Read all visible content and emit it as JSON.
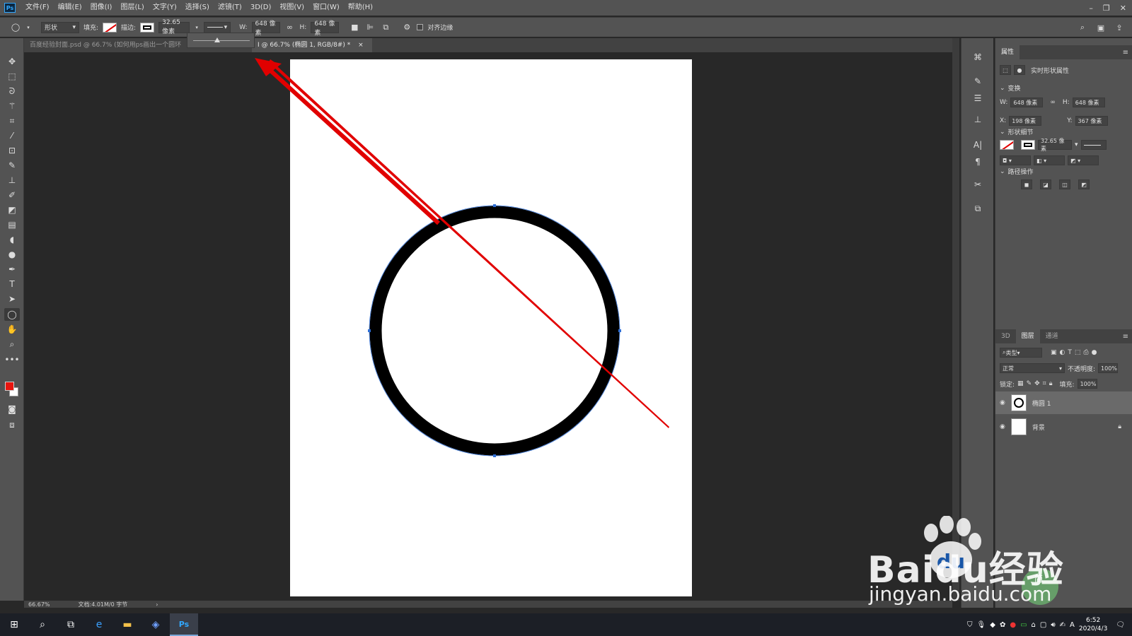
{
  "app": {
    "logo": "Ps"
  },
  "menu": [
    "文件(F)",
    "编辑(E)",
    "图像(I)",
    "图层(L)",
    "文字(Y)",
    "选择(S)",
    "滤镜(T)",
    "3D(D)",
    "视图(V)",
    "窗口(W)",
    "帮助(H)"
  ],
  "options": {
    "mode": "形状",
    "fill_label": "填充:",
    "stroke_label": "描边:",
    "stroke_width": "32.65 像素",
    "w_label": "W:",
    "w_value": "648 像素",
    "h_label": "H:",
    "h_value": "648 像素",
    "align_edges": "对齐边缘"
  },
  "tabs": [
    {
      "label": "百度经验封面.psd @ 66.7% (如何用ps画出一个圆环"
    },
    {
      "label": "I @ 66.7% (椭圆 1, RGB/8#) *",
      "close": "×"
    }
  ],
  "status": {
    "zoom": "66.67%",
    "doc": "文档:4.01M/0 字节",
    "arrow": "›"
  },
  "properties": {
    "tab": "属性",
    "subtitle": "实时形状属性",
    "transform_label": "变换",
    "w_label": "W:",
    "w": "648 像素",
    "h_label": "H:",
    "h": "648 像素",
    "x_label": "X:",
    "x": "198 像素",
    "y_label": "Y:",
    "y": "367 像素",
    "shape_label": "形状细节",
    "stroke_width": "32.65 像素",
    "path_ops_label": "路径操作"
  },
  "layers_panel": {
    "tabs": [
      "3D",
      "图层",
      "通道"
    ],
    "filter": "类型",
    "blend_mode": "正常",
    "opacity_label": "不透明度:",
    "opacity": "100%",
    "lock_label": "锁定:",
    "fill_label": "填充:",
    "fill": "100%",
    "layers": [
      {
        "name": "椭圆 1",
        "selected": true
      },
      {
        "name": "背景",
        "locked": true
      }
    ]
  },
  "taskbar": {
    "time": "6:52",
    "date": "2020/4/3",
    "ime": "A"
  },
  "watermark": {
    "brand": "Baidu经验",
    "url": "jingyan.baidu.com",
    "badge": "简"
  },
  "colors": {
    "foreground": "#e8150f",
    "background": "#ffffff",
    "annotation": "#e10000"
  }
}
